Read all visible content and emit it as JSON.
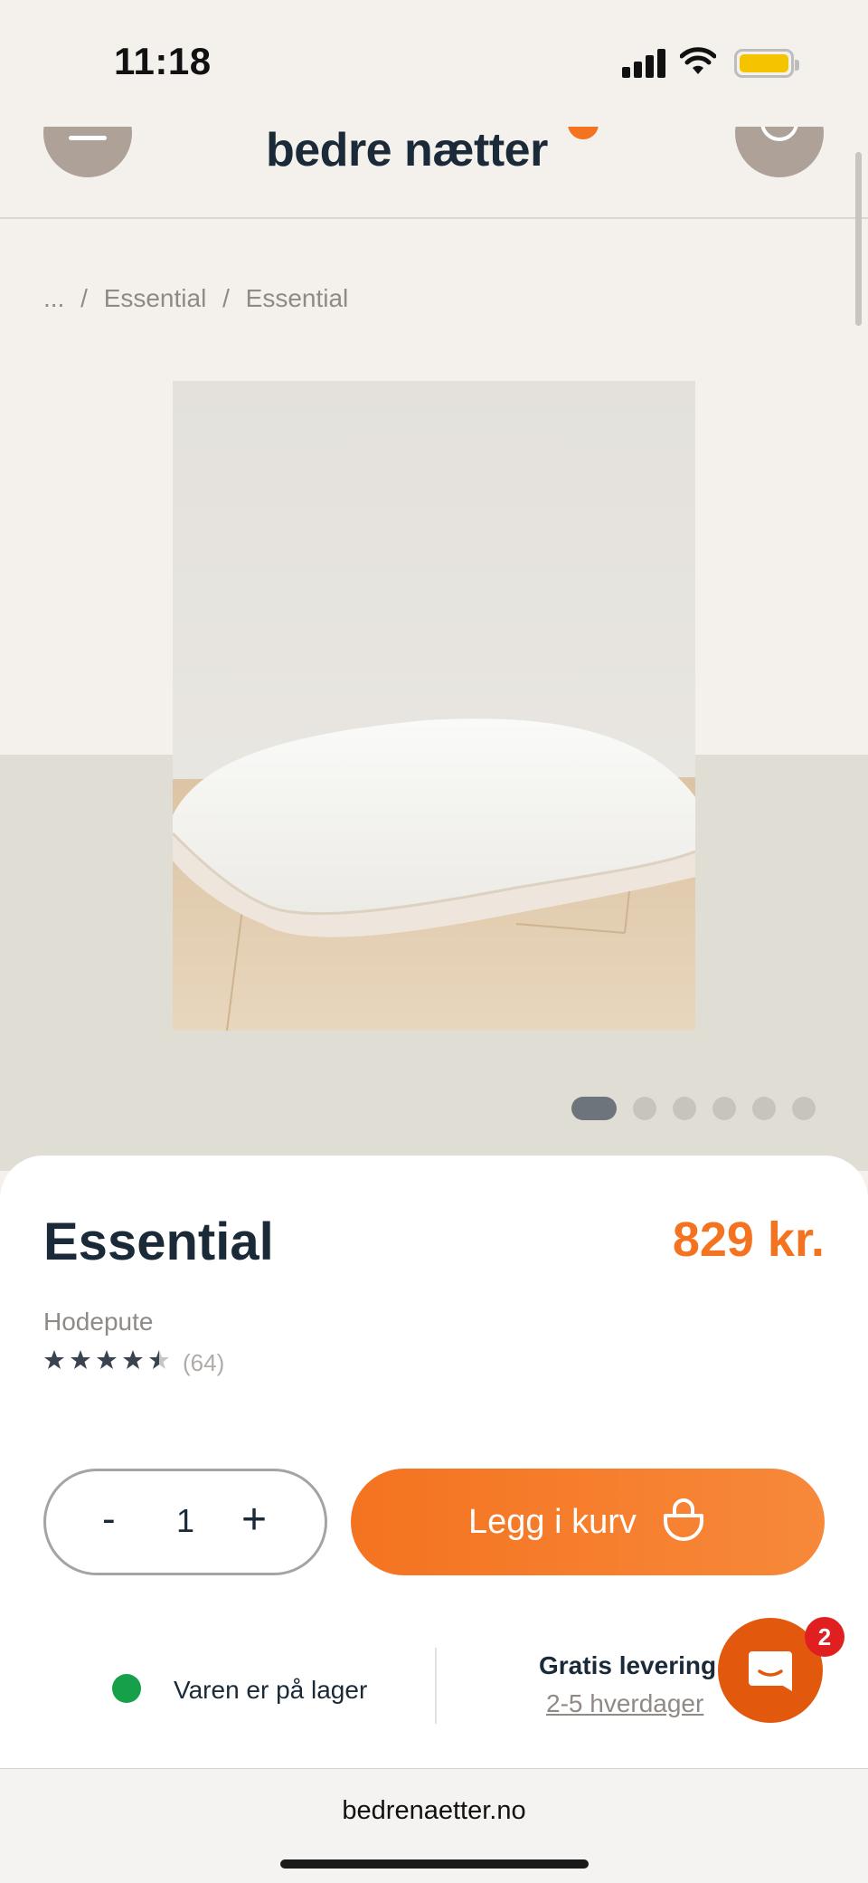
{
  "status_bar": {
    "time": "11:18",
    "icons": [
      "signal-icon",
      "wifi-icon",
      "battery-icon"
    ],
    "battery_color": "#f5c400"
  },
  "header": {
    "logo": "bedre nætter",
    "menu_icon": "menu-icon",
    "account_icon": "user-icon"
  },
  "breadcrumb": {
    "items": [
      "...",
      "/",
      "Essential",
      "/",
      "Essential"
    ]
  },
  "gallery": {
    "slide_count": 6,
    "active_index": 0
  },
  "product": {
    "title": "Essential",
    "price": "829 kr.",
    "category": "Hodepute",
    "rating": 4.5,
    "review_count": "(64)"
  },
  "purchase": {
    "minus_label": "-",
    "quantity": "1",
    "plus_label": "+",
    "add_to_cart_label": "Legg i kurv"
  },
  "info": {
    "stock_text": "Varen er på lager",
    "delivery_title": "Gratis levering",
    "delivery_time": "2-5 hverdager"
  },
  "chat": {
    "badge_count": "2"
  },
  "browser": {
    "url": "bedrenaetter.no"
  },
  "colors": {
    "accent": "#f47320",
    "text_dark": "#1b2a38",
    "in_stock": "#17a04a",
    "chat": "#e2580d",
    "badge": "#e02020"
  }
}
